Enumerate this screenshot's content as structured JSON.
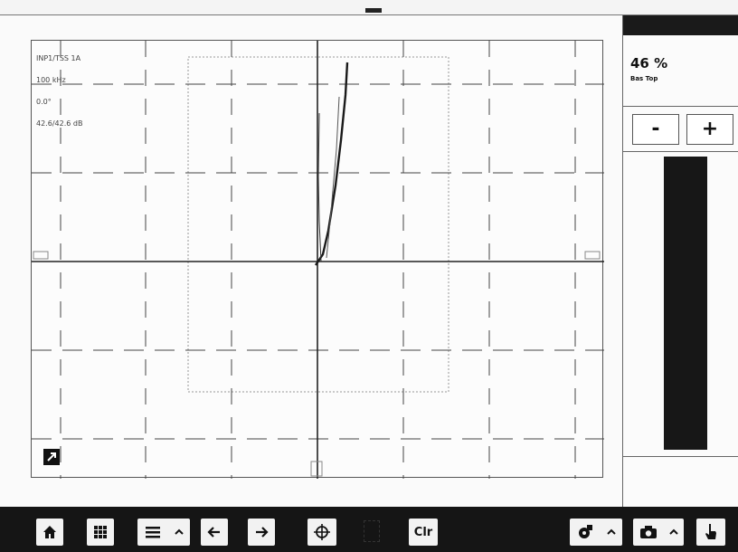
{
  "header": {
    "title_text": ""
  },
  "scope": {
    "info_lines": [
      "INP1/TSS 1A",
      "100 kHz",
      "0.0°",
      "42.6/42.6 dB"
    ],
    "tools": [
      {
        "name": "signal-source-icon"
      },
      {
        "name": "monitor-icon"
      },
      {
        "name": "expand-icon"
      }
    ]
  },
  "panel": {
    "value": "46 %",
    "label": "Bas Top",
    "minus_label": "-",
    "plus_label": "+",
    "level_fraction": 1.0
  },
  "taskbar": {
    "buttons": [
      {
        "name": "home-button",
        "icon": "home-icon"
      },
      {
        "name": "grid-button",
        "icon": "grid-icon"
      },
      {
        "name": "menu-button",
        "icon": "menu-icon"
      },
      {
        "name": "back-button",
        "icon": "arrow-left-icon"
      },
      {
        "name": "forward-button",
        "icon": "arrow-right-icon"
      },
      {
        "name": "crosshair-button",
        "icon": "crosshair-icon"
      },
      {
        "name": "clear-button",
        "label": "Clr"
      },
      {
        "name": "settings-button",
        "icon": "gear-icon"
      },
      {
        "name": "camera-button",
        "icon": "camera-icon"
      },
      {
        "name": "touch-button",
        "icon": "hand-pointer-icon"
      }
    ]
  },
  "colors": {
    "taskbar": "#151515",
    "bar_fill": "#171717",
    "trace": "#1a1a1a",
    "grid": "#444444"
  }
}
